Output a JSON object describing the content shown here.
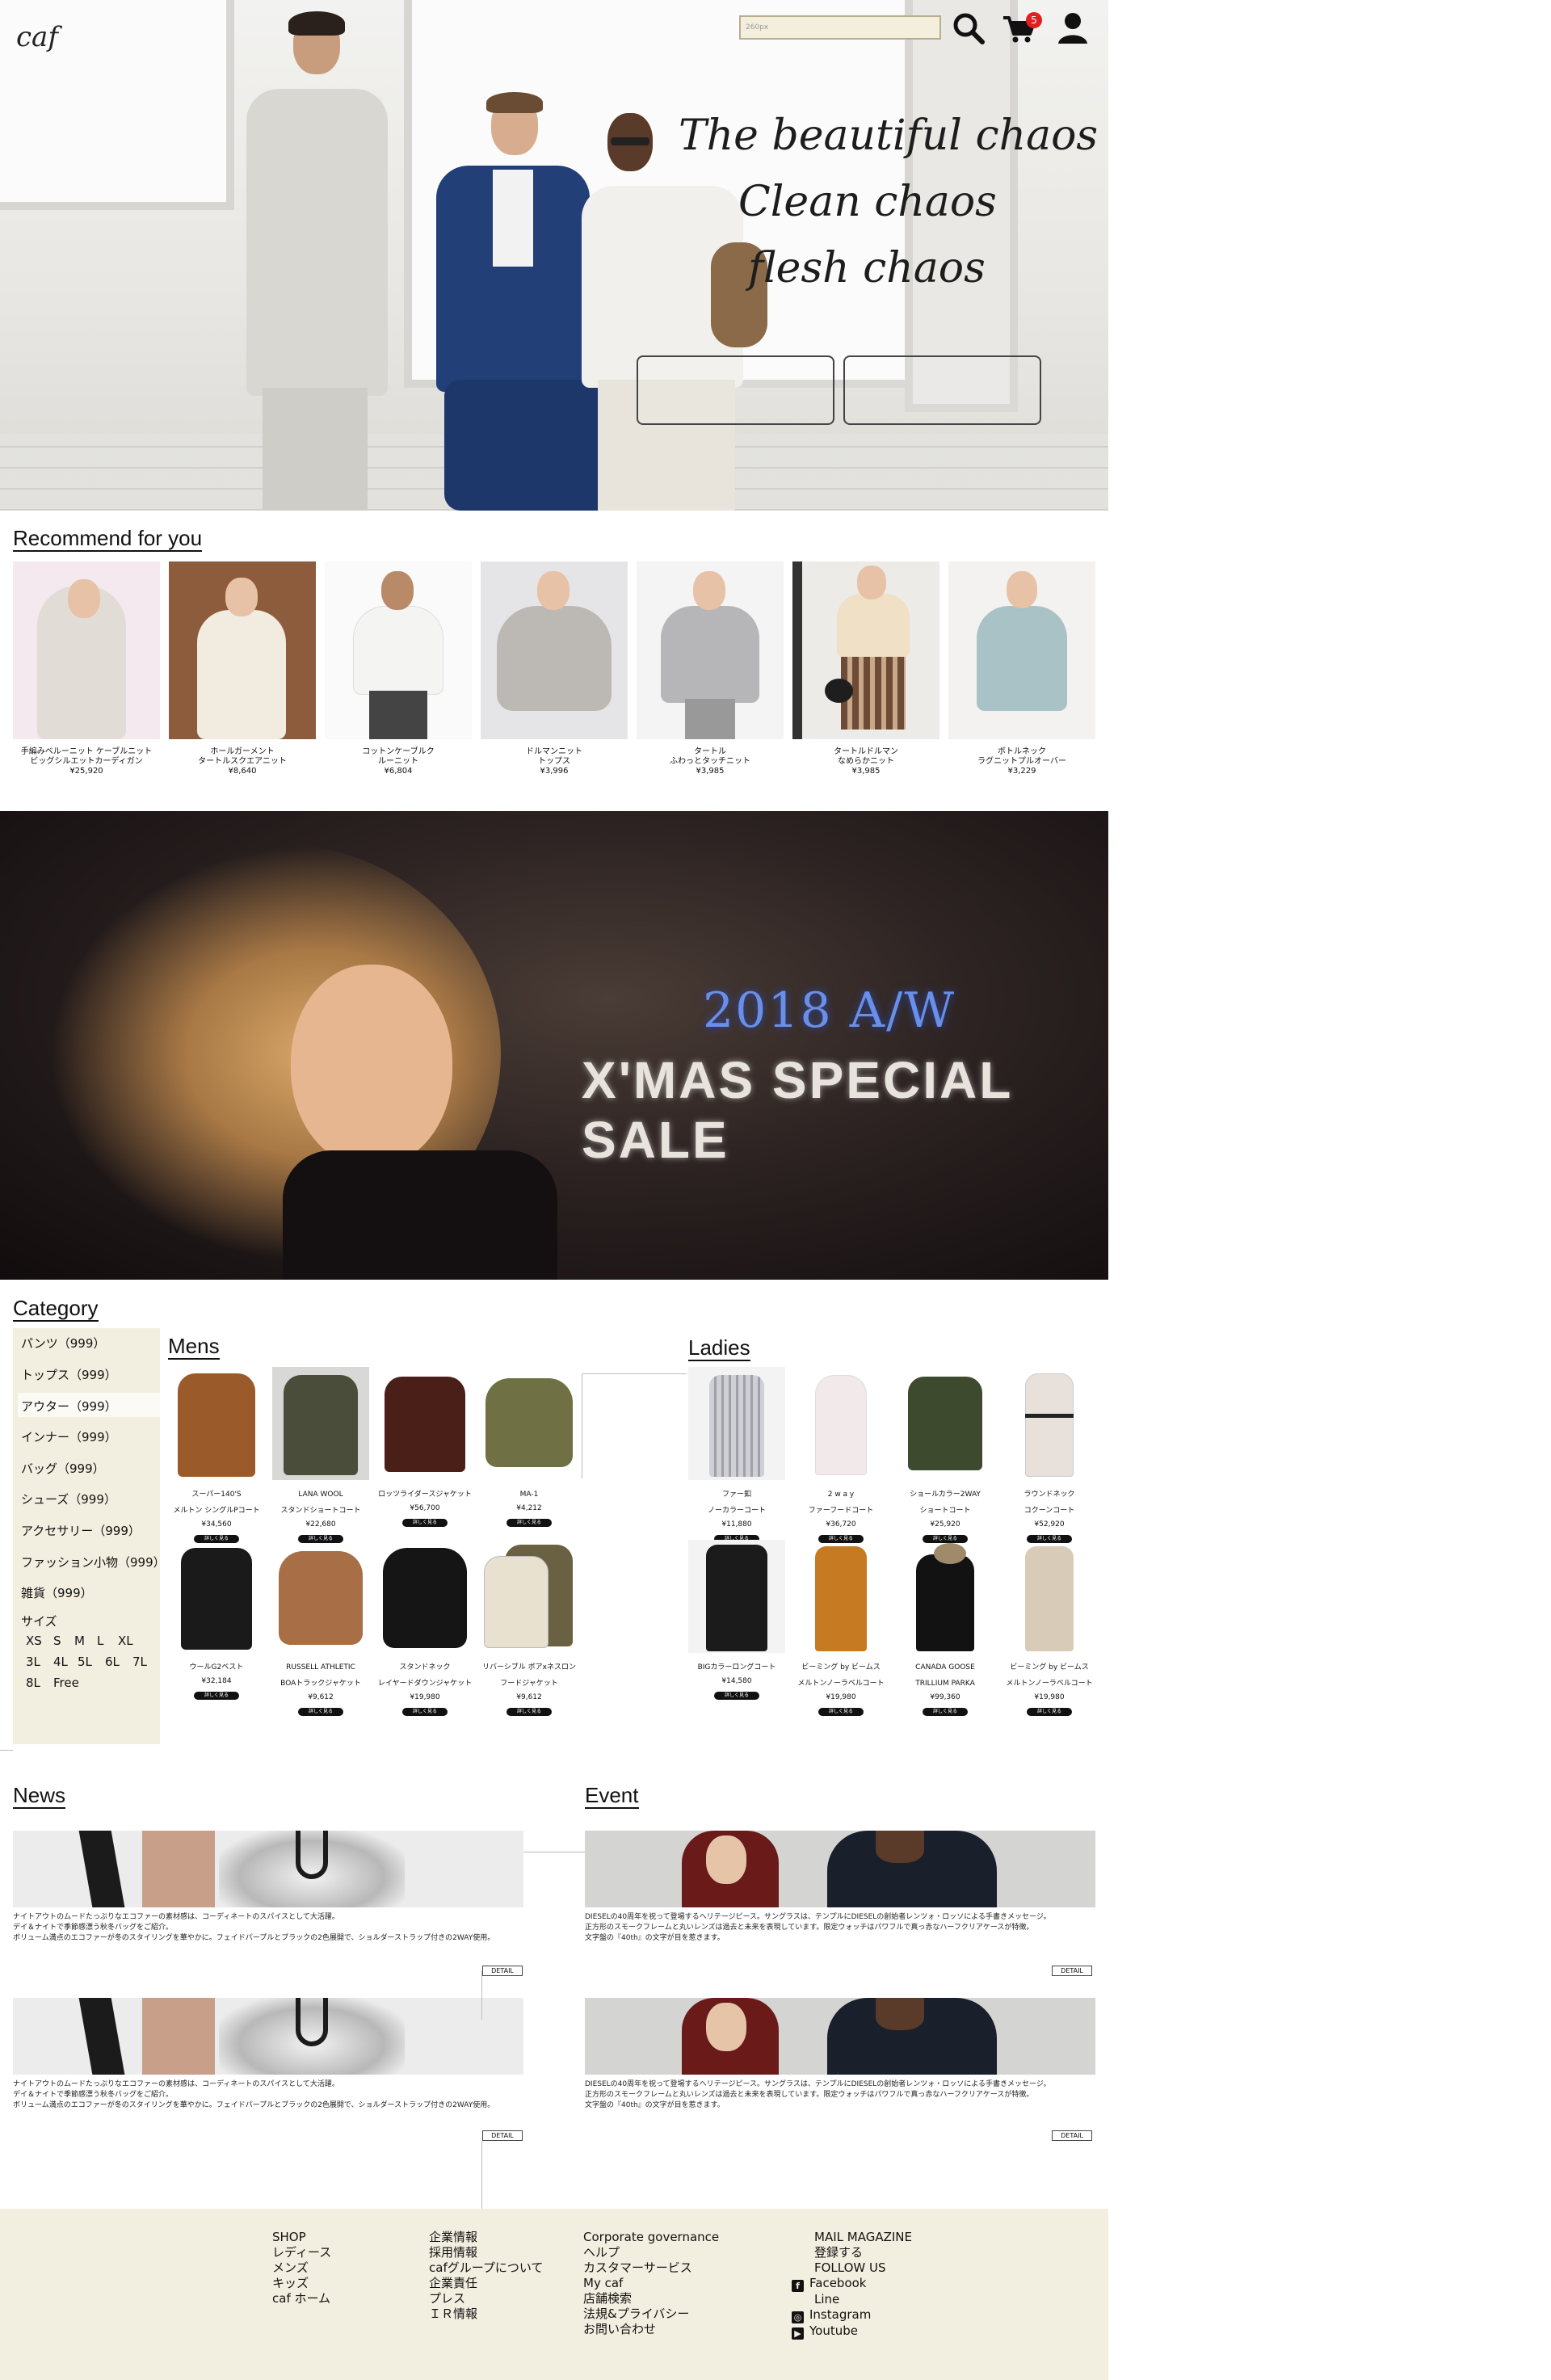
{
  "header": {
    "logo": "caf",
    "search_placeholder": "260px",
    "cart_count": "5",
    "icons": [
      "search-icon",
      "cart-icon",
      "user-icon"
    ]
  },
  "hero": {
    "tagline": [
      "The beautiful chaos",
      "Clean chaos",
      "flesh chaos"
    ]
  },
  "recommend": {
    "title": "Recommend for you",
    "items": [
      {
        "name": "手編みベルーニット ケーブルニット\nビッグシルエットカーディガン",
        "price": "¥25,920"
      },
      {
        "name": "ホールガーメント\nタートルスクエアニット",
        "price": "¥8,640"
      },
      {
        "name": "コットンケーブルク\nルーニット",
        "price": "¥6,804"
      },
      {
        "name": "ドルマンニット\nトップス",
        "price": "¥3,996"
      },
      {
        "name": "タートル\nふわっとタッチニット",
        "price": "¥3,985"
      },
      {
        "name": "タートルドルマン\nなめらかニット",
        "price": "¥3,985"
      },
      {
        "name": "ボトルネック\nラグニットプルオーバー",
        "price": "¥3,229"
      }
    ]
  },
  "sale": {
    "year": "2018 A/W",
    "title": "X'MAS SPECIAL SALE"
  },
  "category": {
    "title": "Category",
    "items": [
      "パンツ（999）",
      "トップス（999）",
      "アウター（999）",
      "インナー（999）",
      "バッグ（999）",
      "シューズ（999）",
      "アクセサリー（999）",
      "ファッション小物（999）",
      "雑貨（999）"
    ],
    "size_label": "サイズ",
    "sizes": [
      "XS",
      "S",
      "M",
      "L",
      "XL",
      "3L",
      "4L",
      "5L",
      "6L",
      "7L",
      "8L",
      "Free"
    ],
    "button_label": "詳しく見る"
  },
  "mens": {
    "title": "Mens",
    "products": [
      {
        "name": "スーパー140'S\nメルトン シングルPコート",
        "price": "¥34,560"
      },
      {
        "name": "LANA WOOL\nスタンドショートコート",
        "price": "¥22,680"
      },
      {
        "name": "ロッツライダースジャケット\n ",
        "price": "¥56,700"
      },
      {
        "name": "MA-1\n ",
        "price": "¥4,212"
      },
      {
        "name": "ウールG2ベスト\n ",
        "price": "¥32,184"
      },
      {
        "name": "RUSSELL ATHLETIC\nBOAトラックジャケット",
        "price": "¥9,612"
      },
      {
        "name": "スタンドネック\nレイヤードダウンジャケット",
        "price": "¥19,980"
      },
      {
        "name": "リバーシブル ボアxネスロン\nフードジャケット",
        "price": "¥9,612"
      }
    ]
  },
  "ladies": {
    "title": "Ladies",
    "products": [
      {
        "name": "ファー釦\nノーカラーコート",
        "price": "¥11,880"
      },
      {
        "name": "2 w a y\nファーフードコート",
        "price": "¥36,720"
      },
      {
        "name": "ショールカラー2WAY\nショートコート",
        "price": "¥25,920"
      },
      {
        "name": "ラウンドネック\nコクーンコート",
        "price": "¥52,920"
      },
      {
        "name": "BIGカラーロングコート\n ",
        "price": "¥14,580"
      },
      {
        "name": "ビーミング by ビームス\nメルトンノーラベルコート",
        "price": "¥19,980"
      },
      {
        "name": "CANADA GOOSE\nTRILLIUM PARKA",
        "price": "¥99,360"
      },
      {
        "name": "ビーミング by ビームス\nメルトンノーラベルコート",
        "price": "¥19,980"
      }
    ]
  },
  "news": {
    "title": "News",
    "items": [
      {
        "text": "ナイトアウトのムードたっぷりなエコファーの素材感は、コーディネートのスパイスとして大活躍。\nデイ＆ナイトで季節感漂う秋冬バッグをご紹介。\nボリューム満点のエコファーが冬のスタイリングを華やかに。フェイドパープルとブラックの2色展開で、ショルダーストラップ付きの2WAY使用。",
        "button": "DETAIL"
      },
      {
        "text": "ナイトアウトのムードたっぷりなエコファーの素材感は、コーディネートのスパイスとして大活躍。\nデイ＆ナイトで季節感漂う秋冬バッグをご紹介。\nボリューム満点のエコファーが冬のスタイリングを華やかに。フェイドパープルとブラックの2色展開で、ショルダーストラップ付きの2WAY使用。",
        "button": "DETAIL"
      }
    ]
  },
  "event": {
    "title": "Event",
    "items": [
      {
        "text": "DIESELの40周年を祝って登場するヘリテージピース。サングラスは、テンプルにDIESELの創始者レンツォ・ロッソによる手書きメッセージ。\n正方形のスモークフレームと丸いレンズは過去と未来を表現しています。限定ウォッチはパワフルで真っ赤なハーフクリアケースが特徴。\n文字盤の『40th』の文字が目を惹きます。",
        "button": "DETAIL"
      },
      {
        "text": "DIESELの40周年を祝って登場するヘリテージピース。サングラスは、テンプルにDIESELの創始者レンツォ・ロッソによる手書きメッセージ。\n正方形のスモークフレームと丸いレンズは過去と未来を表現しています。限定ウォッチはパワフルで真っ赤なハーフクリアケースが特徴。\n文字盤の『40th』の文字が目を惹きます。",
        "button": "DETAIL"
      }
    ]
  },
  "footer": {
    "col1": [
      "SHOP",
      "レディース",
      "メンズ",
      "キッズ",
      "caf ホーム"
    ],
    "col2": [
      "企業情報",
      "採用情報",
      "cafグループについて",
      "企業責任",
      "プレス",
      "ＩＲ情報"
    ],
    "col3": [
      "Corporate governance",
      "ヘルプ",
      "カスタマーサービス",
      "My caf",
      "店舗検索",
      "法規&プライバシー",
      "お問い合わせ"
    ],
    "col4": [
      "MAIL MAGAZINE",
      "登録する",
      "FOLLOW US"
    ],
    "social": [
      {
        "label": "Facebook",
        "icon": "facebook-icon",
        "glyph": "f"
      },
      {
        "label": "Line",
        "icon": "",
        "glyph": ""
      },
      {
        "label": "Instagram",
        "icon": "instagram-icon",
        "glyph": "◎"
      },
      {
        "label": "Youtube",
        "icon": "youtube-icon",
        "glyph": "▶"
      }
    ]
  },
  "colors": {
    "panel_bg": "#f3efe0",
    "badge": "#e02020",
    "sale_year": "#6a8fe8"
  }
}
